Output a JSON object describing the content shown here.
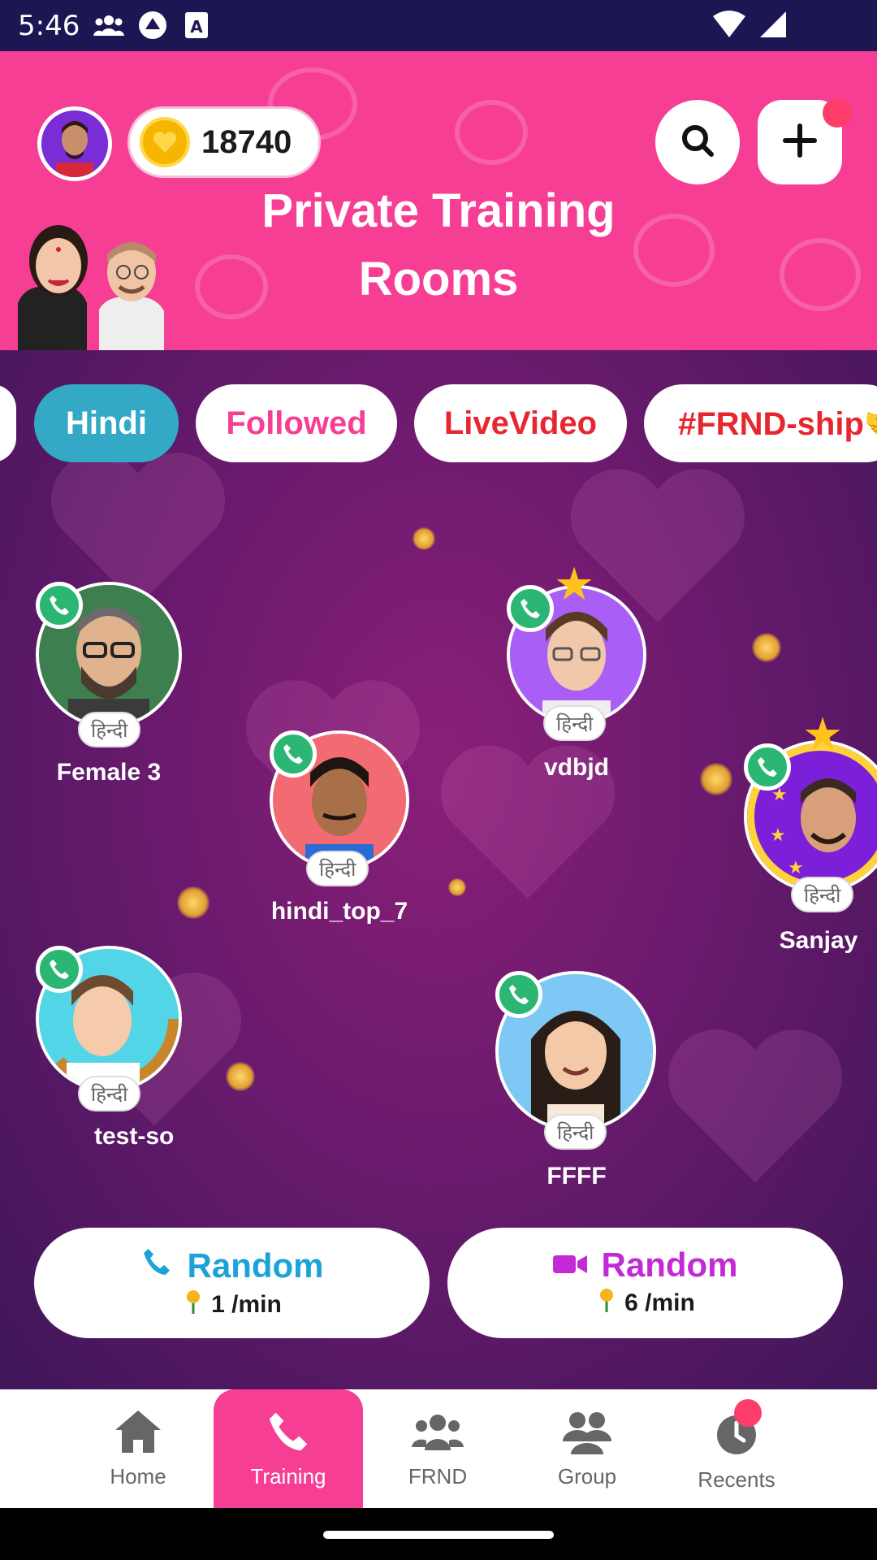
{
  "status_bar": {
    "time": "5:46"
  },
  "header": {
    "coins": "18740",
    "title": "Private Training Rooms"
  },
  "filters": [
    {
      "label": "Hindi",
      "color": "#ffffff"
    },
    {
      "label": "Followed",
      "color": "#f63f94"
    },
    {
      "label": "LiveVideo",
      "color": "#e8262f"
    },
    {
      "label": "#FRND-ship🤝",
      "color": "#e8262f"
    }
  ],
  "users": [
    {
      "name": "Female 3",
      "lang": "हिन्दी"
    },
    {
      "name": "vdbjd",
      "lang": "हिन्दी"
    },
    {
      "name": "hindi_top_7",
      "lang": "हिन्दी"
    },
    {
      "name": "Sanjay",
      "lang": "हिन्दी"
    },
    {
      "name": "test-so",
      "lang": "हिन्दी"
    },
    {
      "name": "FFFF",
      "lang": "हिन्दी"
    }
  ],
  "random_audio": {
    "label": "Random",
    "rate": "1 /min",
    "color": "#1aa3d6"
  },
  "random_video": {
    "label": "Random",
    "rate": "6 /min",
    "color": "#c32ad6"
  },
  "nav": [
    {
      "label": "Home"
    },
    {
      "label": "Training"
    },
    {
      "label": "FRND"
    },
    {
      "label": "Group"
    },
    {
      "label": "Recents"
    }
  ]
}
